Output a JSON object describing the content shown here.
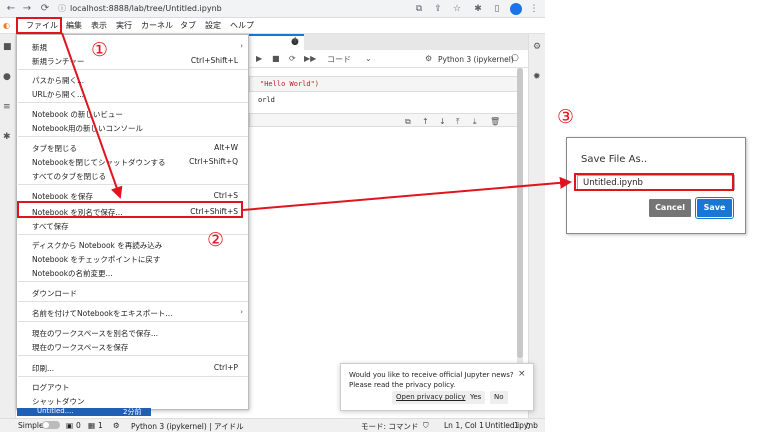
{
  "browser": {
    "url": "localhost:8888/lab/tree/Untitled.ipynb",
    "back_icon": "arrow-left-icon",
    "forward_icon": "arrow-right-icon",
    "reload_icon": "reload-icon"
  },
  "menubar": {
    "items": [
      "ファイル",
      "編集",
      "表示",
      "実行",
      "カーネル",
      "タブ",
      "設定",
      "ヘルプ"
    ]
  },
  "file_menu": {
    "items": [
      {
        "label": "新規",
        "shortcut": ""
      },
      {
        "label": "新規ランチャー",
        "shortcut": "Ctrl+Shift+L"
      },
      {
        "label": "パスから開く...",
        "shortcut": ""
      },
      {
        "label": "URLから開く...",
        "shortcut": ""
      },
      {
        "label": "Notebook の新しいビュー",
        "shortcut": ""
      },
      {
        "label": "Notebook用の新しいコンソール",
        "shortcut": ""
      },
      {
        "label": "タブを閉じる",
        "shortcut": "Alt+W"
      },
      {
        "label": "Notebookを閉じてシャットダウンする",
        "shortcut": "Ctrl+Shift+Q"
      },
      {
        "label": "すべてのタブを閉じる",
        "shortcut": ""
      },
      {
        "label": "Notebook を保存",
        "shortcut": "Ctrl+S"
      },
      {
        "label": "Notebook を別名で保存...",
        "shortcut": "Ctrl+Shift+S"
      },
      {
        "label": "すべて保存",
        "shortcut": ""
      },
      {
        "label": "ディスクから Notebook を再読み込み",
        "shortcut": ""
      },
      {
        "label": "Notebook をチェックポイントに戻す",
        "shortcut": ""
      },
      {
        "label": "Notebookの名前変更...",
        "shortcut": ""
      },
      {
        "label": "ダウンロード",
        "shortcut": ""
      },
      {
        "label": "名前を付けてNotebookをエキスポート...",
        "shortcut": ""
      },
      {
        "label": "現在のワークスペースを別名で保存...",
        "shortcut": ""
      },
      {
        "label": "現在のワークスペースを保存",
        "shortcut": ""
      },
      {
        "label": "印刷...",
        "shortcut": "Ctrl+P"
      },
      {
        "label": "ログアウト",
        "shortcut": ""
      },
      {
        "label": "シャットダウン",
        "shortcut": ""
      }
    ]
  },
  "notebook": {
    "toolbar_cell_type": "コード",
    "kernel": "Python 3 (ipykernel)",
    "code": "\"Hello World\")",
    "output": "orld"
  },
  "annotations": {
    "step1": "①",
    "step2": "②",
    "step3": "③",
    "accent": "#e0141e"
  },
  "news_popup": {
    "line1": "Would you like to receive official Jupyter news?",
    "line2": "Please read the privacy policy.",
    "link": "Open privacy policy",
    "yes": "Yes",
    "no": "No",
    "close": "×"
  },
  "file_tab": {
    "name": "Untitled....",
    "age": "2分前"
  },
  "statusbar": {
    "simple": "Simple",
    "count1": "0",
    "count2": "1",
    "kernel": "Python 3 (ipykernel) | アイドル",
    "mode": "モード: コマンド",
    "position": "Ln 1, Col 1",
    "filename": "Untitled.ipynb",
    "notif": "1"
  },
  "dialog": {
    "title": "Save File As..",
    "value": "Untitled.ipynb",
    "cancel": "Cancel",
    "save": "Save"
  }
}
